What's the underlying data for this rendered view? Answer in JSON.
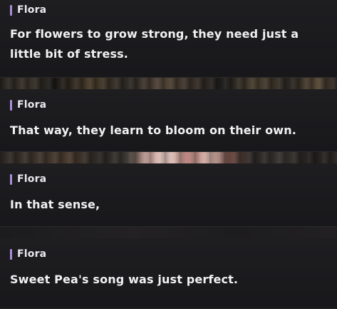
{
  "accent_color": "#a98cd6",
  "entries": [
    {
      "speaker": "Flora",
      "text": "For flowers to grow strong, they need just a little bit of stress."
    },
    {
      "speaker": "Flora",
      "text": "That way, they learn to bloom on their own."
    },
    {
      "speaker": "Flora",
      "text": "In that sense,"
    },
    {
      "speaker": "Flora",
      "text": "Sweet Pea's song was just perfect."
    }
  ]
}
